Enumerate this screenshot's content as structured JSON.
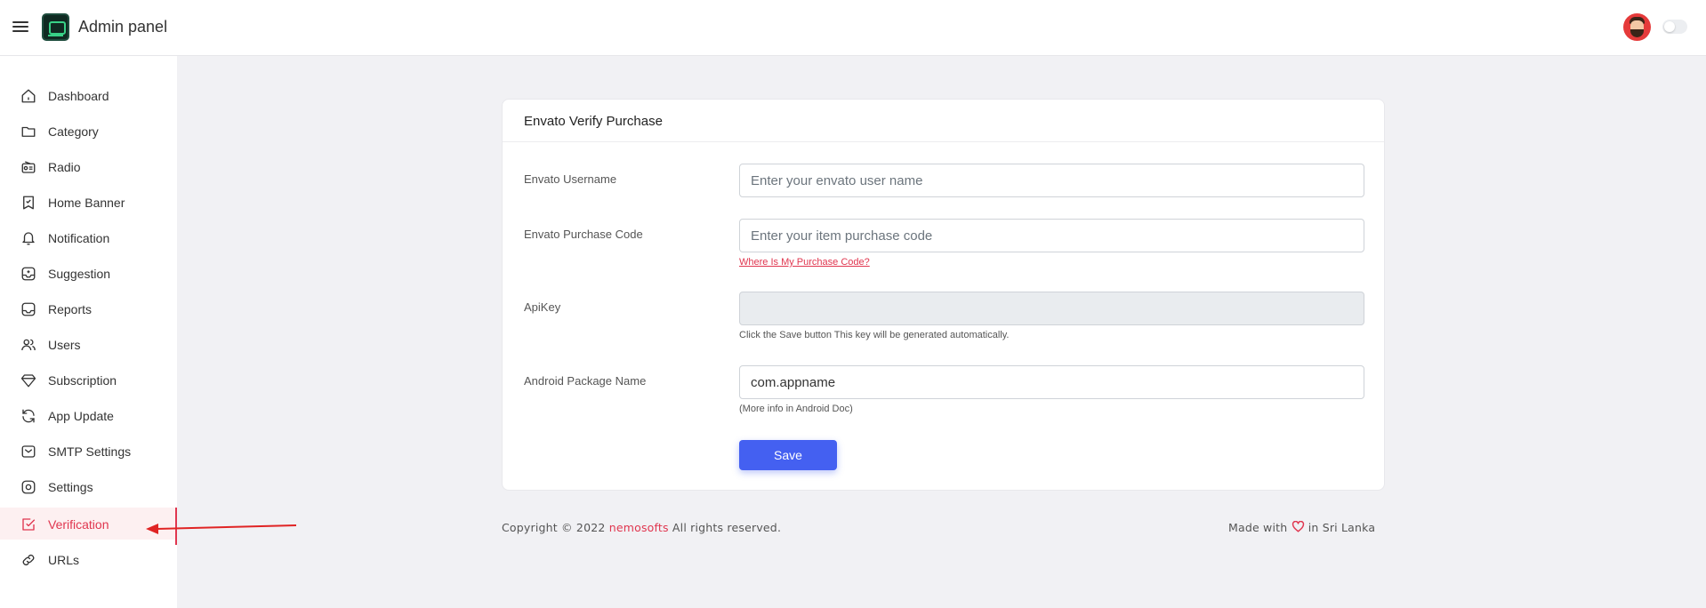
{
  "header": {
    "menu_icon": "hamburger-icon",
    "logo_icon": "radio-app-logo",
    "title": "Admin panel",
    "avatar_icon": "user-avatar",
    "theme_toggle_icon": "toggle-switch"
  },
  "sidebar": {
    "active_color": "#e0364f",
    "items": [
      {
        "label": "Dashboard",
        "icon": "home-icon"
      },
      {
        "label": "Category",
        "icon": "folder-icon"
      },
      {
        "label": "Radio",
        "icon": "radio-icon"
      },
      {
        "label": "Home Banner",
        "icon": "banner-icon"
      },
      {
        "label": "Notification",
        "icon": "bell-icon"
      },
      {
        "label": "Suggestion",
        "icon": "suggestion-icon"
      },
      {
        "label": "Reports",
        "icon": "reports-icon"
      },
      {
        "label": "Users",
        "icon": "users-icon"
      },
      {
        "label": "Subscription",
        "icon": "diamond-icon"
      },
      {
        "label": "App Update",
        "icon": "refresh-icon"
      },
      {
        "label": "SMTP Settings",
        "icon": "mail-icon"
      },
      {
        "label": "Settings",
        "icon": "gear-icon"
      },
      {
        "label": "Verification",
        "icon": "checkbox-icon",
        "active": true
      },
      {
        "label": "URLs",
        "icon": "link-icon"
      }
    ]
  },
  "form": {
    "title": "Envato Verify Purchase",
    "username": {
      "label": "Envato Username",
      "placeholder": "Enter your envato user name",
      "value": ""
    },
    "purchase_code": {
      "label": "Envato Purchase Code",
      "placeholder": "Enter your item purchase code",
      "value": "",
      "help_link": "Where Is My Purchase Code?"
    },
    "api_key": {
      "label": "ApiKey",
      "value": "",
      "help": "Click the Save button This key will be generated automatically."
    },
    "package_name": {
      "label": "Android Package Name",
      "value": "com.appname",
      "help": "(More info in Android Doc)"
    },
    "save_label": "Save",
    "button_color": "#4460f1"
  },
  "footer": {
    "copyright_prefix": "Copyright © 2022 ",
    "company": "nemosofts",
    "copyright_suffix": " All rights reserved.",
    "made_with_prefix": "Made with ",
    "heart_icon": "heart-icon",
    "made_with_suffix": " in Sri Lanka"
  }
}
